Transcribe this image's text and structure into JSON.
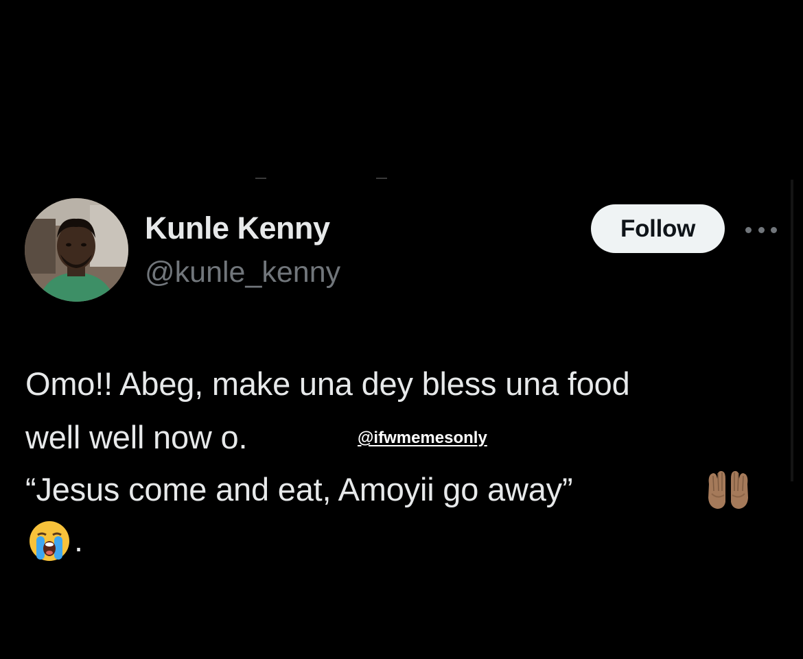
{
  "tweet": {
    "author": {
      "display_name": "Kunle Kenny",
      "handle": "@kunle_kenny",
      "avatar_icon": "profile-photo"
    },
    "follow_label": "Follow",
    "more_icon": "more-horizontal-icon",
    "text_lines": [
      "Omo!! Abeg, make una dey bless una food",
      "well well now o.",
      "“Jesus come and eat, Amoyii go away”",
      "."
    ],
    "emojis": [
      "palms-up-together-medium-skin-tone",
      "loudly-crying-face"
    ]
  },
  "watermark": "@ifwmemesonly",
  "colors": {
    "background": "#000000",
    "primary_text": "#e7e9ea",
    "secondary_text": "#71767b",
    "follow_button_bg": "#eff3f4",
    "follow_button_text": "#0f1419"
  }
}
